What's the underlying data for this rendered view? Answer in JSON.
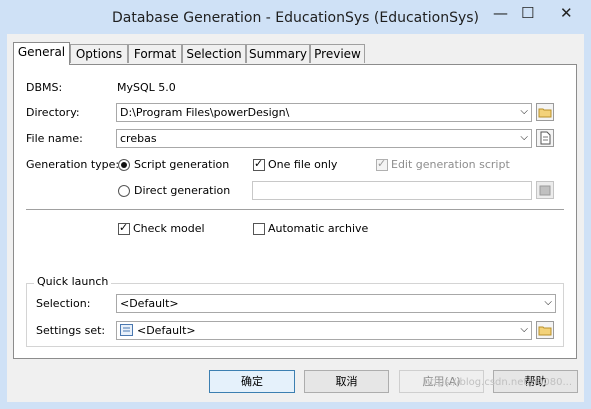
{
  "window": {
    "title": "Database Generation - EducationSys (EducationSys)",
    "minimize_glyph": "—",
    "maximize_glyph": "☐",
    "close_glyph": "✕"
  },
  "tabs": [
    {
      "label": "General",
      "active": true
    },
    {
      "label": "Options"
    },
    {
      "label": "Format"
    },
    {
      "label": "Selection"
    },
    {
      "label": "Summary"
    },
    {
      "label": "Preview"
    }
  ],
  "general": {
    "dbms_label": "DBMS:",
    "dbms_value": "MySQL 5.0",
    "directory_label": "Directory:",
    "directory_value": "D:\\Program Files\\powerDesign\\",
    "filename_label": "File name:",
    "filename_value": "crebas",
    "gentype_label": "Generation type:",
    "script_generation": "Script generation",
    "direct_generation": "Direct generation",
    "one_file_only": "One file only",
    "edit_generation_script": "Edit generation script",
    "check_model": "Check model",
    "automatic_archive": "Automatic archive"
  },
  "quick_launch": {
    "title": "Quick launch",
    "selection_label": "Selection:",
    "selection_value": "<Default>",
    "settings_label": "Settings set:",
    "settings_value": "<Default>"
  },
  "buttons": {
    "ok": "确定",
    "cancel": "取消",
    "apply": "应用(A)",
    "help": "帮助"
  },
  "watermark": "https://blog.csdn.net/u0080...",
  "glyphs": {
    "check": "✓",
    "arrow": "⌵",
    "folder": "🗀"
  }
}
